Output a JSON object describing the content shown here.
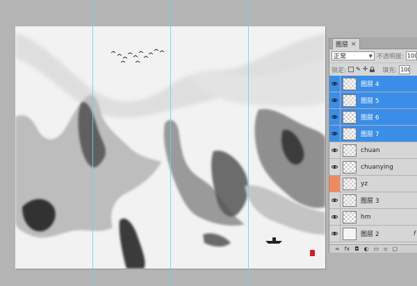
{
  "panel": {
    "tab_label": "图层",
    "close_glyph": "×",
    "blend_mode": "正常",
    "opacity_label": "不透明度:",
    "opacity_value": "100",
    "lock_label": "锁定:",
    "fill_label": "填充:",
    "fill_value": "100"
  },
  "layers": [
    {
      "name": "图层 4",
      "selected": true,
      "visible": true
    },
    {
      "name": "图层 5",
      "selected": true,
      "visible": true
    },
    {
      "name": "图层 6",
      "selected": true,
      "visible": true
    },
    {
      "name": "图层 7",
      "selected": true,
      "visible": true
    },
    {
      "name": "chuan",
      "selected": false,
      "visible": true
    },
    {
      "name": "chuanying",
      "selected": false,
      "visible": true
    },
    {
      "name": "yz",
      "selected": false,
      "visible": false
    },
    {
      "name": "图层 3",
      "selected": false,
      "visible": true
    },
    {
      "name": "hm",
      "selected": false,
      "visible": true
    },
    {
      "name": "图层 2",
      "selected": false,
      "visible": true
    }
  ],
  "footer": {
    "link_icon": "∞",
    "fx_icon": "fx",
    "mask_icon": "◘",
    "adjust_icon": "◐",
    "folder_icon": "▭",
    "new_icon": "▫",
    "trash_icon": "▢",
    "fx_mark": "f"
  },
  "colors": {
    "selection": "#3b8ee8",
    "guide": "#5fd8e6",
    "highlight_eye": "#f08a5c",
    "seal": "#d81c1c"
  }
}
